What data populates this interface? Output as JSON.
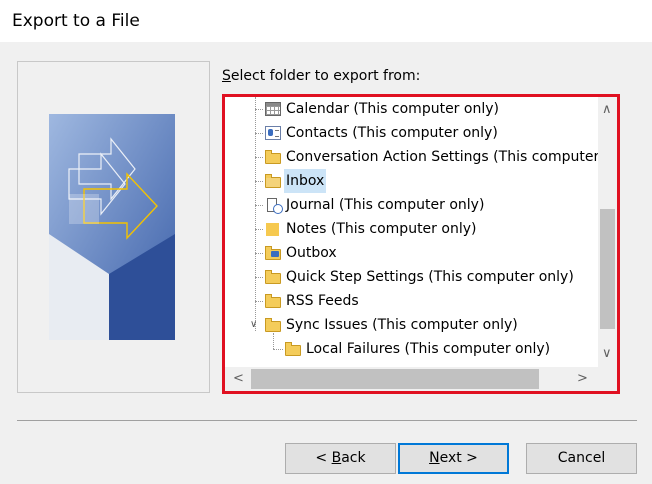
{
  "window": {
    "title": "Export to a File"
  },
  "prompt": {
    "prefix": "S",
    "rest": "elect folder to export from:"
  },
  "tree": {
    "items": [
      {
        "label": "Calendar (This computer only)",
        "icon": "calendar-icon"
      },
      {
        "label": "Contacts (This computer only)",
        "icon": "contacts-icon"
      },
      {
        "label": "Conversation Action Settings (This computer",
        "icon": "folder-icon"
      },
      {
        "label": "Inbox",
        "icon": "inbox-icon",
        "selected": true
      },
      {
        "label": "Journal (This computer only)",
        "icon": "journal-icon"
      },
      {
        "label": "Notes (This computer only)",
        "icon": "notes-icon"
      },
      {
        "label": "Outbox",
        "icon": "outbox-icon"
      },
      {
        "label": "Quick Step Settings (This computer only)",
        "icon": "folder-icon"
      },
      {
        "label": "RSS Feeds",
        "icon": "folder-icon"
      },
      {
        "label": "Sync Issues (This computer only)",
        "icon": "folder-icon",
        "expanded": true
      },
      {
        "label": "Local Failures (This computer only)",
        "icon": "folder-icon"
      }
    ]
  },
  "buttons": {
    "back": {
      "prefix": "< ",
      "mnemonic": "B",
      "rest": "ack"
    },
    "next": {
      "mnemonic": "N",
      "rest": "ext >"
    },
    "cancel": {
      "label": "Cancel"
    }
  },
  "colors": {
    "highlight_border": "#e01021",
    "selection": "#cce4f7"
  }
}
